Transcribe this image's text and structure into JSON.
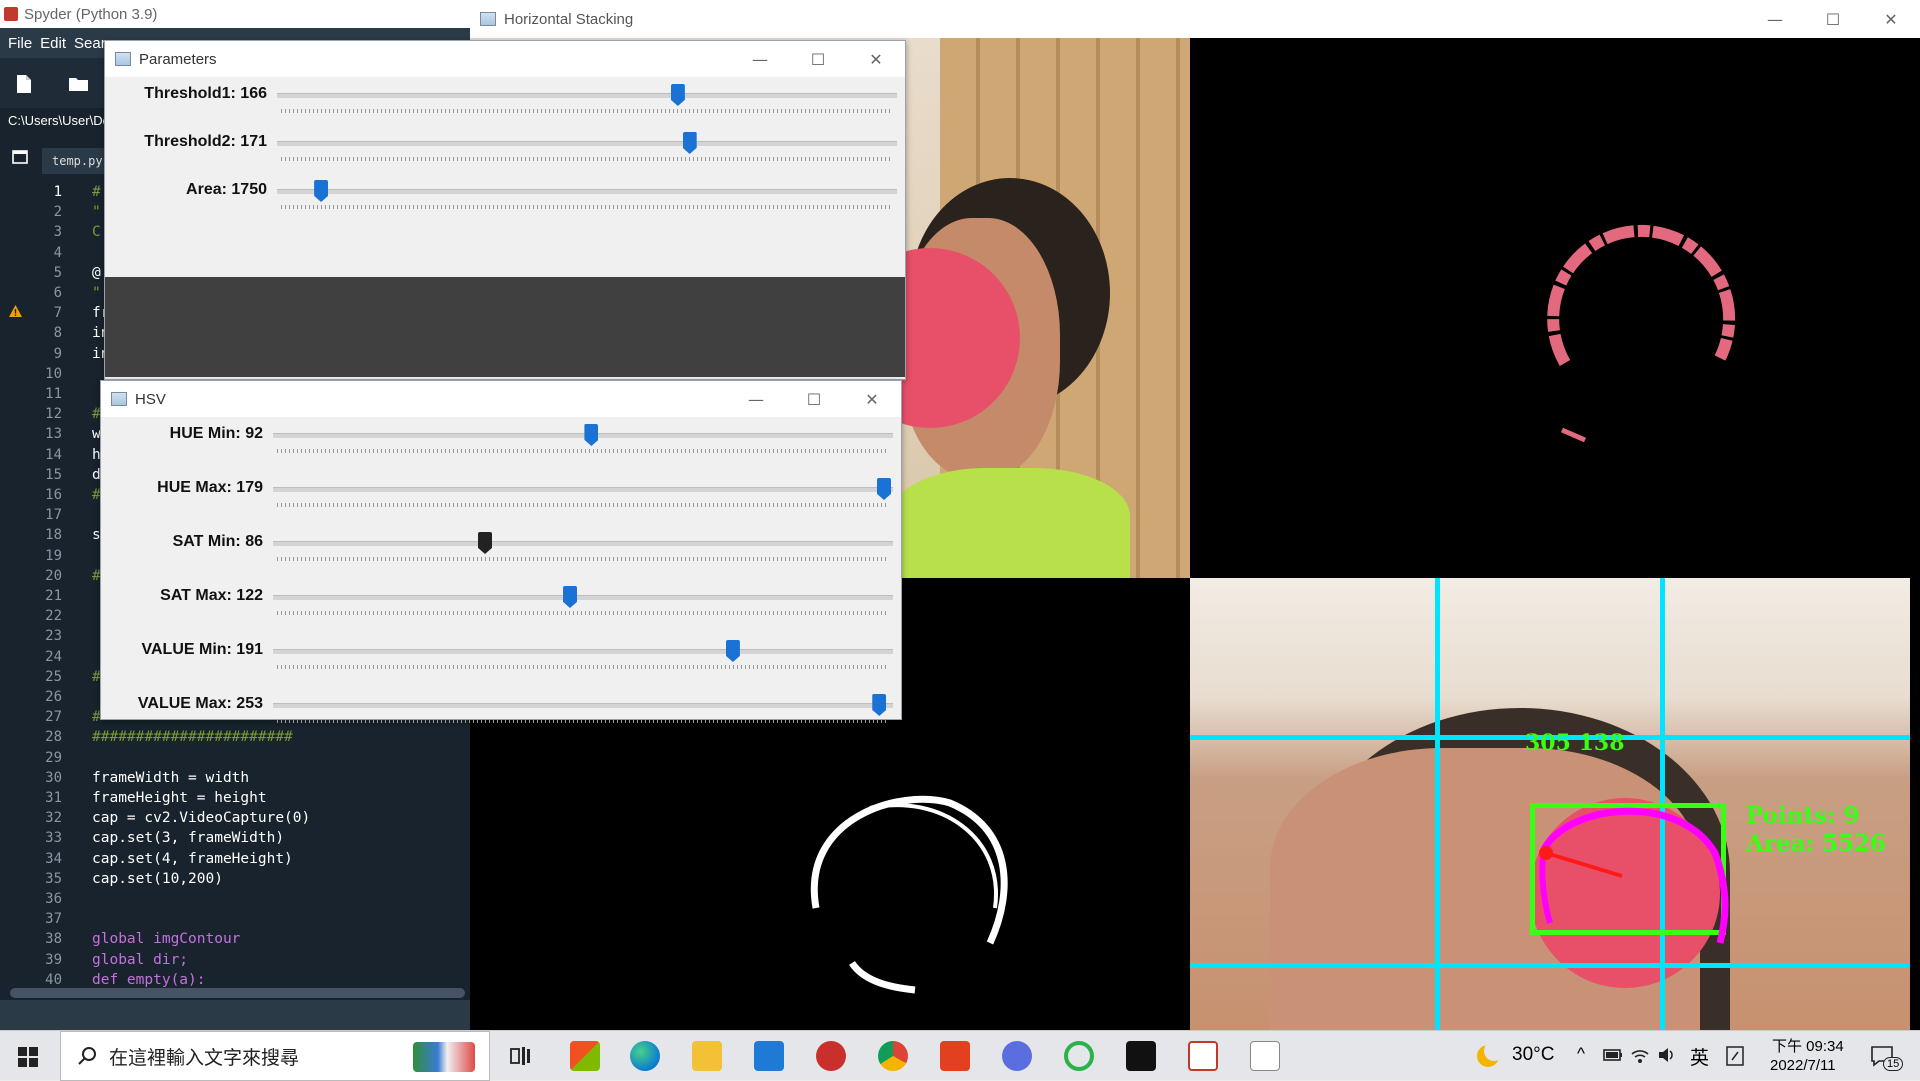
{
  "spyder": {
    "title": "Spyder (Python 3.9)",
    "menu": [
      "File",
      "Edit",
      "Sear"
    ],
    "path": "C:\\Users\\User\\De",
    "file_tab": "temp.py",
    "code_lines": [
      {
        "n": 1,
        "text": "#"
      },
      {
        "n": 2,
        "text": "\""
      },
      {
        "n": 3,
        "text": "C"
      },
      {
        "n": 4,
        "text": ""
      },
      {
        "n": 5,
        "text": "@"
      },
      {
        "n": 6,
        "text": "\""
      },
      {
        "n": 7,
        "text": "fr"
      },
      {
        "n": 8,
        "text": "in"
      },
      {
        "n": 9,
        "text": "in"
      },
      {
        "n": 10,
        "text": ""
      },
      {
        "n": 11,
        "text": ""
      },
      {
        "n": 12,
        "text": "#"
      },
      {
        "n": 13,
        "text": "w"
      },
      {
        "n": 14,
        "text": "h"
      },
      {
        "n": 15,
        "text": "d"
      },
      {
        "n": 16,
        "text": "#"
      },
      {
        "n": 17,
        "text": ""
      },
      {
        "n": 18,
        "text": "s"
      },
      {
        "n": 19,
        "text": ""
      },
      {
        "n": 20,
        "text": "#"
      },
      {
        "n": 21,
        "text": ""
      },
      {
        "n": 22,
        "text": ""
      },
      {
        "n": 23,
        "text": ""
      },
      {
        "n": 24,
        "text": ""
      },
      {
        "n": 25,
        "text": "#"
      },
      {
        "n": 26,
        "text": ""
      },
      {
        "n": 27,
        "text": "#"
      },
      {
        "n": 28,
        "text": "#######################"
      },
      {
        "n": 29,
        "text": ""
      },
      {
        "n": 30,
        "text": "frameWidth = width"
      },
      {
        "n": 31,
        "text": "frameHeight = height"
      },
      {
        "n": 32,
        "text": "cap = cv2.VideoCapture(0)"
      },
      {
        "n": 33,
        "text": "cap.set(3, frameWidth)"
      },
      {
        "n": 34,
        "text": "cap.set(4, frameHeight)"
      },
      {
        "n": 35,
        "text": "cap.set(10,200)"
      },
      {
        "n": 36,
        "text": ""
      },
      {
        "n": 37,
        "text": ""
      },
      {
        "n": 38,
        "text": "global imgContour"
      },
      {
        "n": 39,
        "text": "global dir;"
      },
      {
        "n": 40,
        "text": "def empty(a):"
      }
    ]
  },
  "stacking": {
    "title": "Horizontal Stacking",
    "overlay_points": "Points: 9",
    "overlay_area": "Area: 5526",
    "overlay_top": "305 138"
  },
  "parameters": {
    "title": "Parameters",
    "trackbars": [
      {
        "label": "Threshold1: 166",
        "value": 166,
        "max": 255
      },
      {
        "label": "Threshold2: 171",
        "value": 171,
        "max": 255
      },
      {
        "label": "Area: 1750",
        "value": 1750,
        "max": 30000
      }
    ]
  },
  "hsv": {
    "title": "HSV",
    "trackbars": [
      {
        "label": "HUE Min: 92",
        "value": 92,
        "max": 179
      },
      {
        "label": "HUE Max: 179",
        "value": 179,
        "max": 179
      },
      {
        "label": "SAT Min: 86",
        "value": 86,
        "max": 255
      },
      {
        "label": "SAT Max: 122",
        "value": 122,
        "max": 255
      },
      {
        "label": "VALUE Min: 191",
        "value": 191,
        "max": 255
      },
      {
        "label": "VALUE Max: 253",
        "value": 253,
        "max": 255
      }
    ]
  },
  "taskbar": {
    "search_placeholder": "在這裡輸入文字來搜尋",
    "weather": "30°C",
    "ime": "英",
    "time_period": "下午 09:34",
    "date": "2022/7/11",
    "notification_count": "15"
  },
  "colors": {
    "accent_blue": "#1a72d4",
    "spyder_bg": "#19232d",
    "cyan_grid": "#00e5ff",
    "overlay_green": "#39ff14",
    "magenta": "#ff00ff"
  }
}
